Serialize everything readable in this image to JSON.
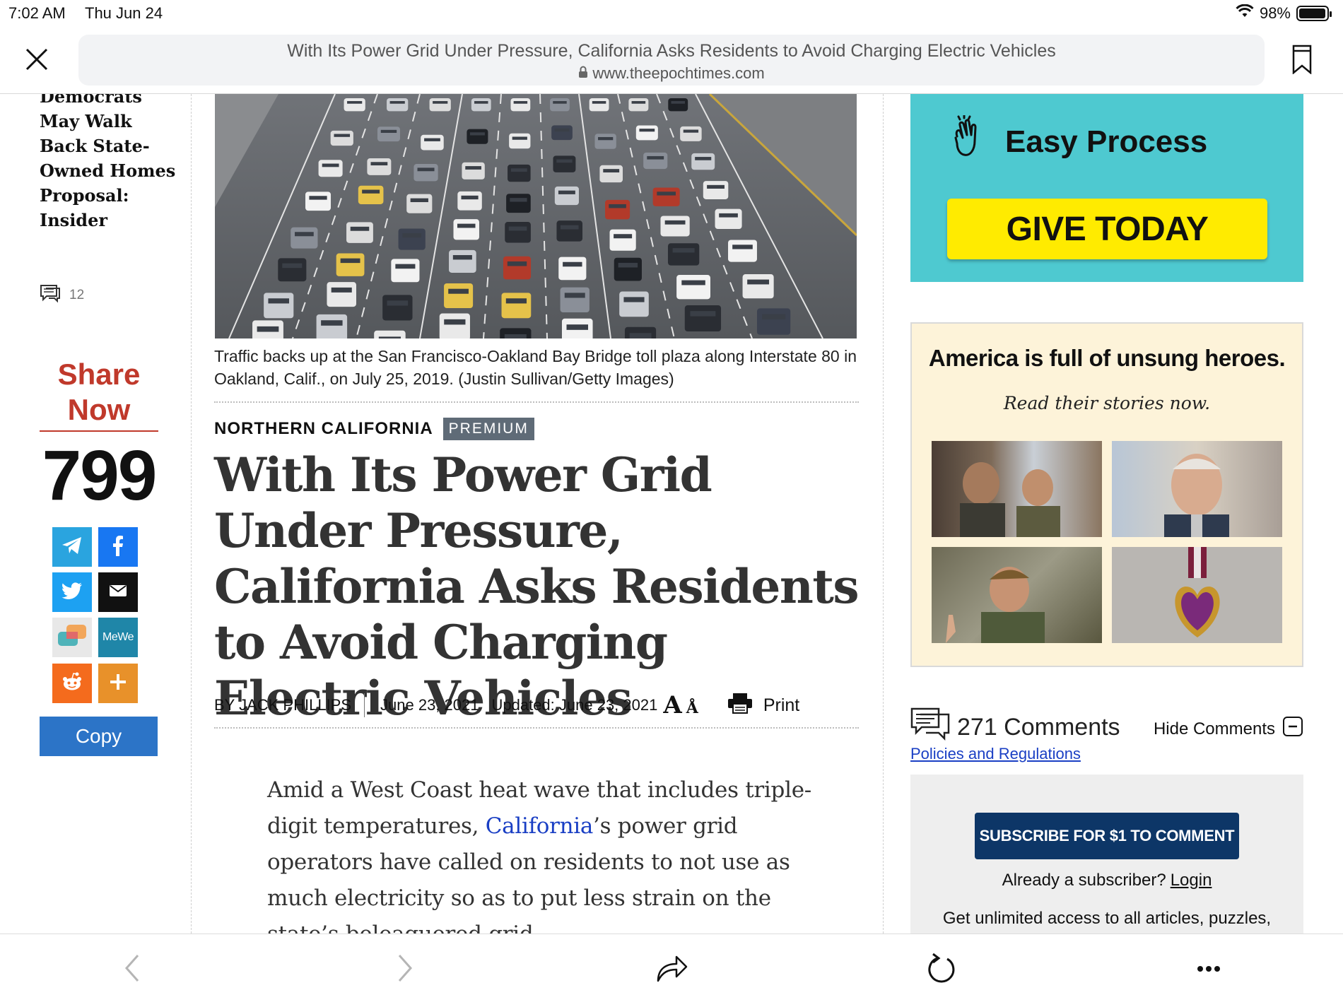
{
  "status_bar": {
    "time": "7:02 AM",
    "date": "Thu Jun 24",
    "battery": "98%",
    "battery_level": 0.98
  },
  "browser": {
    "page_title": "With Its Power Grid Under Pressure, California Asks Residents to Avoid Charging Electric Vehicles",
    "domain": "www.theepochtimes.com"
  },
  "related": {
    "title": "Democrats May Walk Back State-Owned Homes Proposal: Insider",
    "comments": "12"
  },
  "share": {
    "heading": "Share Now",
    "count": "799",
    "buttons": [
      "telegram",
      "facebook",
      "twitter",
      "email",
      "messages",
      "MeWe",
      "reddit",
      "more"
    ],
    "mewe_label": "MeWe",
    "copy_label": "Copy"
  },
  "article": {
    "caption": "Traffic backs up at the San Francisco-Oakland Bay Bridge toll plaza along Interstate 80 in Oakland, Calif., on July 25, 2019. (Justin Sullivan/Getty Images)",
    "section": "NORTHERN CALIFORNIA",
    "badge": "PREMIUM",
    "headline": "With Its Power Grid Under Pressure, California Asks Residents to Avoid Charging Electric Vehicles",
    "author": "BY JACK PHILLIPS",
    "date": "June 23, 2021",
    "updated": "Updated: June 23, 2021",
    "print_label": "Print",
    "body_before_link": "Amid a West Coast heat wave that includes triple-digit temperatures, ",
    "body_link": "California",
    "body_after_link": "’s power grid operators have called on residents to not use as much electricity so as to put less strain on the state’s beleaguered grid."
  },
  "ads": {
    "easy_process": "Easy Process",
    "give_today": "GIVE TODAY",
    "heroes_title": "America is full of unsung heroes.",
    "heroes_subtitle": "Read their stories now."
  },
  "comments": {
    "count": "271 Comments",
    "hide_label": "Hide Comments",
    "policies": "Policies and Regulations",
    "subscribe": "SUBSCRIBE FOR $1 TO COMMENT",
    "already": "Already a subscriber?",
    "login": "Login",
    "unlimited": "Get unlimited access to all articles, puzzles,"
  },
  "colors": {
    "share_red": "#c0392b",
    "copy_blue": "#2c74c7",
    "donate_teal": "#4ec9d0",
    "give_yellow": "#ffeb00",
    "subscribe_navy": "#0d3667",
    "link_blue": "#1a3fc4"
  },
  "icons": {
    "close": "close-icon",
    "bookmark": "bookmark-icon",
    "lock": "lock-icon",
    "back": "chevron-left-icon",
    "forward": "chevron-right-icon",
    "share": "share-icon",
    "reload": "reload-icon",
    "more": "ellipsis-icon"
  }
}
